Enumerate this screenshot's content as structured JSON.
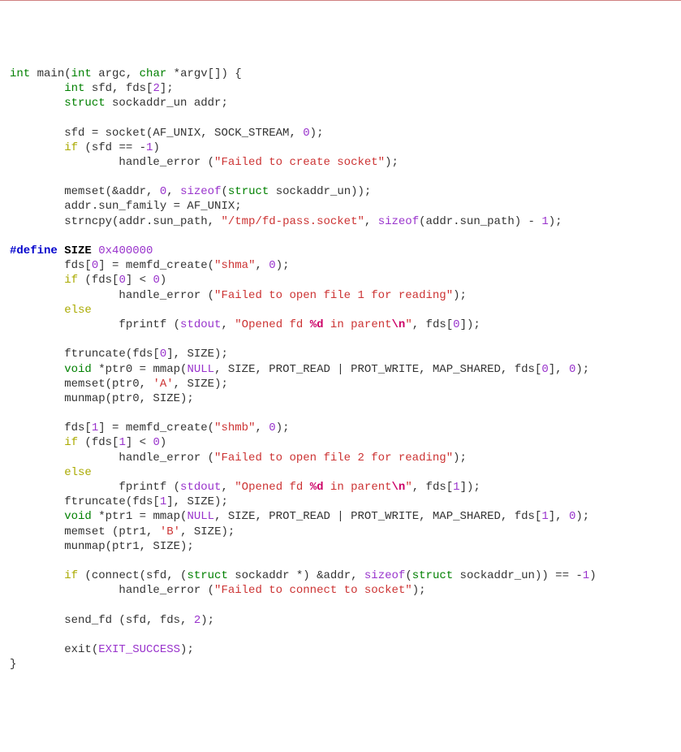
{
  "code": {
    "lines": [
      [
        {
          "t": "int ",
          "c": "kw-type"
        },
        {
          "t": "main(",
          "c": "fn"
        },
        {
          "t": "int ",
          "c": "kw-type"
        },
        {
          "t": "argc, ",
          "c": "id"
        },
        {
          "t": "char ",
          "c": "kw-type"
        },
        {
          "t": "*argv[]) {",
          "c": "sym"
        }
      ],
      [
        {
          "t": "        ",
          "c": "sym"
        },
        {
          "t": "int ",
          "c": "kw-type"
        },
        {
          "t": "sfd, fds[",
          "c": "id"
        },
        {
          "t": "2",
          "c": "num"
        },
        {
          "t": "];",
          "c": "sym"
        }
      ],
      [
        {
          "t": "        ",
          "c": "sym"
        },
        {
          "t": "struct ",
          "c": "kw-type"
        },
        {
          "t": "sockaddr_un addr;",
          "c": "id"
        }
      ],
      [],
      [
        {
          "t": "        sfd = socket(AF_UNIX, SOCK_STREAM, ",
          "c": "id"
        },
        {
          "t": "0",
          "c": "num"
        },
        {
          "t": ");",
          "c": "sym"
        }
      ],
      [
        {
          "t": "        ",
          "c": "sym"
        },
        {
          "t": "if",
          "c": "kw-ctrl"
        },
        {
          "t": " (sfd == -",
          "c": "id"
        },
        {
          "t": "1",
          "c": "num"
        },
        {
          "t": ")",
          "c": "sym"
        }
      ],
      [
        {
          "t": "                handle_error (",
          "c": "id"
        },
        {
          "t": "\"Failed to create socket\"",
          "c": "str"
        },
        {
          "t": ");",
          "c": "sym"
        }
      ],
      [],
      [
        {
          "t": "        memset(&addr, ",
          "c": "id"
        },
        {
          "t": "0",
          "c": "num"
        },
        {
          "t": ", ",
          "c": "sym"
        },
        {
          "t": "sizeof",
          "c": "specialfn"
        },
        {
          "t": "(",
          "c": "sym"
        },
        {
          "t": "struct ",
          "c": "kw-type"
        },
        {
          "t": "sockaddr_un));",
          "c": "id"
        }
      ],
      [
        {
          "t": "        addr.sun_family = AF_UNIX;",
          "c": "id"
        }
      ],
      [
        {
          "t": "        strncpy(addr.sun_path, ",
          "c": "id"
        },
        {
          "t": "\"/tmp/fd-pass.socket\"",
          "c": "str"
        },
        {
          "t": ", ",
          "c": "sym"
        },
        {
          "t": "sizeof",
          "c": "specialfn"
        },
        {
          "t": "(addr.sun_path) - ",
          "c": "id"
        },
        {
          "t": "1",
          "c": "num"
        },
        {
          "t": ");",
          "c": "sym"
        }
      ],
      [],
      [
        {
          "t": "#define ",
          "c": "pp"
        },
        {
          "t": "SIZE ",
          "c": "macro"
        },
        {
          "t": "0x400000",
          "c": "num"
        }
      ],
      [
        {
          "t": "        fds[",
          "c": "id"
        },
        {
          "t": "0",
          "c": "num"
        },
        {
          "t": "] = memfd_create(",
          "c": "id"
        },
        {
          "t": "\"shma\"",
          "c": "str"
        },
        {
          "t": ", ",
          "c": "sym"
        },
        {
          "t": "0",
          "c": "num"
        },
        {
          "t": ");",
          "c": "sym"
        }
      ],
      [
        {
          "t": "        ",
          "c": "sym"
        },
        {
          "t": "if",
          "c": "kw-ctrl"
        },
        {
          "t": " (fds[",
          "c": "id"
        },
        {
          "t": "0",
          "c": "num"
        },
        {
          "t": "] < ",
          "c": "id"
        },
        {
          "t": "0",
          "c": "num"
        },
        {
          "t": ")",
          "c": "sym"
        }
      ],
      [
        {
          "t": "                handle_error (",
          "c": "id"
        },
        {
          "t": "\"Failed to open file 1 for reading\"",
          "c": "str"
        },
        {
          "t": ");",
          "c": "sym"
        }
      ],
      [
        {
          "t": "        ",
          "c": "sym"
        },
        {
          "t": "else",
          "c": "kw-ctrl"
        }
      ],
      [
        {
          "t": "                fprintf (",
          "c": "id"
        },
        {
          "t": "stdout",
          "c": "stdfn"
        },
        {
          "t": ", ",
          "c": "sym"
        },
        {
          "t": "\"Opened fd ",
          "c": "str"
        },
        {
          "t": "%d",
          "c": "fmt"
        },
        {
          "t": " in parent",
          "c": "str"
        },
        {
          "t": "\\n",
          "c": "esc"
        },
        {
          "t": "\"",
          "c": "str"
        },
        {
          "t": ", fds[",
          "c": "id"
        },
        {
          "t": "0",
          "c": "num"
        },
        {
          "t": "]);",
          "c": "sym"
        }
      ],
      [],
      [
        {
          "t": "        ftruncate(fds[",
          "c": "id"
        },
        {
          "t": "0",
          "c": "num"
        },
        {
          "t": "], SIZE);",
          "c": "id"
        }
      ],
      [
        {
          "t": "        ",
          "c": "sym"
        },
        {
          "t": "void ",
          "c": "kw-type"
        },
        {
          "t": "*ptr0 = mmap(",
          "c": "id"
        },
        {
          "t": "NULL",
          "c": "upper"
        },
        {
          "t": ", SIZE, PROT_READ | PROT_WRITE, MAP_SHARED, fds[",
          "c": "id"
        },
        {
          "t": "0",
          "c": "num"
        },
        {
          "t": "], ",
          "c": "id"
        },
        {
          "t": "0",
          "c": "num"
        },
        {
          "t": ");",
          "c": "sym"
        }
      ],
      [
        {
          "t": "        memset(ptr0, ",
          "c": "id"
        },
        {
          "t": "'A'",
          "c": "str"
        },
        {
          "t": ", SIZE);",
          "c": "id"
        }
      ],
      [
        {
          "t": "        munmap(ptr0, SIZE);",
          "c": "id"
        }
      ],
      [],
      [
        {
          "t": "        fds[",
          "c": "id"
        },
        {
          "t": "1",
          "c": "num"
        },
        {
          "t": "] = memfd_create(",
          "c": "id"
        },
        {
          "t": "\"shmb\"",
          "c": "str"
        },
        {
          "t": ", ",
          "c": "sym"
        },
        {
          "t": "0",
          "c": "num"
        },
        {
          "t": ");",
          "c": "sym"
        }
      ],
      [
        {
          "t": "        ",
          "c": "sym"
        },
        {
          "t": "if",
          "c": "kw-ctrl"
        },
        {
          "t": " (fds[",
          "c": "id"
        },
        {
          "t": "1",
          "c": "num"
        },
        {
          "t": "] < ",
          "c": "id"
        },
        {
          "t": "0",
          "c": "num"
        },
        {
          "t": ")",
          "c": "sym"
        }
      ],
      [
        {
          "t": "                handle_error (",
          "c": "id"
        },
        {
          "t": "\"Failed to open file 2 for reading\"",
          "c": "str"
        },
        {
          "t": ");",
          "c": "sym"
        }
      ],
      [
        {
          "t": "        ",
          "c": "sym"
        },
        {
          "t": "else",
          "c": "kw-ctrl"
        }
      ],
      [
        {
          "t": "                fprintf (",
          "c": "id"
        },
        {
          "t": "stdout",
          "c": "stdfn"
        },
        {
          "t": ", ",
          "c": "sym"
        },
        {
          "t": "\"Opened fd ",
          "c": "str"
        },
        {
          "t": "%d",
          "c": "fmt"
        },
        {
          "t": " in parent",
          "c": "str"
        },
        {
          "t": "\\n",
          "c": "esc"
        },
        {
          "t": "\"",
          "c": "str"
        },
        {
          "t": ", fds[",
          "c": "id"
        },
        {
          "t": "1",
          "c": "num"
        },
        {
          "t": "]);",
          "c": "sym"
        }
      ],
      [
        {
          "t": "        ftruncate(fds[",
          "c": "id"
        },
        {
          "t": "1",
          "c": "num"
        },
        {
          "t": "], SIZE);",
          "c": "id"
        }
      ],
      [
        {
          "t": "        ",
          "c": "sym"
        },
        {
          "t": "void ",
          "c": "kw-type"
        },
        {
          "t": "*ptr1 = mmap(",
          "c": "id"
        },
        {
          "t": "NULL",
          "c": "upper"
        },
        {
          "t": ", SIZE, PROT_READ | PROT_WRITE, MAP_SHARED, fds[",
          "c": "id"
        },
        {
          "t": "1",
          "c": "num"
        },
        {
          "t": "], ",
          "c": "id"
        },
        {
          "t": "0",
          "c": "num"
        },
        {
          "t": ");",
          "c": "sym"
        }
      ],
      [
        {
          "t": "        memset (ptr1, ",
          "c": "id"
        },
        {
          "t": "'B'",
          "c": "str"
        },
        {
          "t": ", SIZE);",
          "c": "id"
        }
      ],
      [
        {
          "t": "        munmap(ptr1, SIZE);",
          "c": "id"
        }
      ],
      [],
      [
        {
          "t": "        ",
          "c": "sym"
        },
        {
          "t": "if",
          "c": "kw-ctrl"
        },
        {
          "t": " (connect(sfd, (",
          "c": "id"
        },
        {
          "t": "struct ",
          "c": "kw-type"
        },
        {
          "t": "sockaddr *) &addr, ",
          "c": "id"
        },
        {
          "t": "sizeof",
          "c": "specialfn"
        },
        {
          "t": "(",
          "c": "sym"
        },
        {
          "t": "struct ",
          "c": "kw-type"
        },
        {
          "t": "sockaddr_un)) == -",
          "c": "id"
        },
        {
          "t": "1",
          "c": "num"
        },
        {
          "t": ")",
          "c": "sym"
        }
      ],
      [
        {
          "t": "                handle_error (",
          "c": "id"
        },
        {
          "t": "\"Failed to connect to socket\"",
          "c": "str"
        },
        {
          "t": ");",
          "c": "sym"
        }
      ],
      [],
      [
        {
          "t": "        send_fd (sfd, fds, ",
          "c": "id"
        },
        {
          "t": "2",
          "c": "num"
        },
        {
          "t": ");",
          "c": "sym"
        }
      ],
      [],
      [
        {
          "t": "        exit(",
          "c": "id"
        },
        {
          "t": "EXIT_SUCCESS",
          "c": "upper"
        },
        {
          "t": ");",
          "c": "sym"
        }
      ],
      [
        {
          "t": "}",
          "c": "sym"
        }
      ]
    ]
  }
}
